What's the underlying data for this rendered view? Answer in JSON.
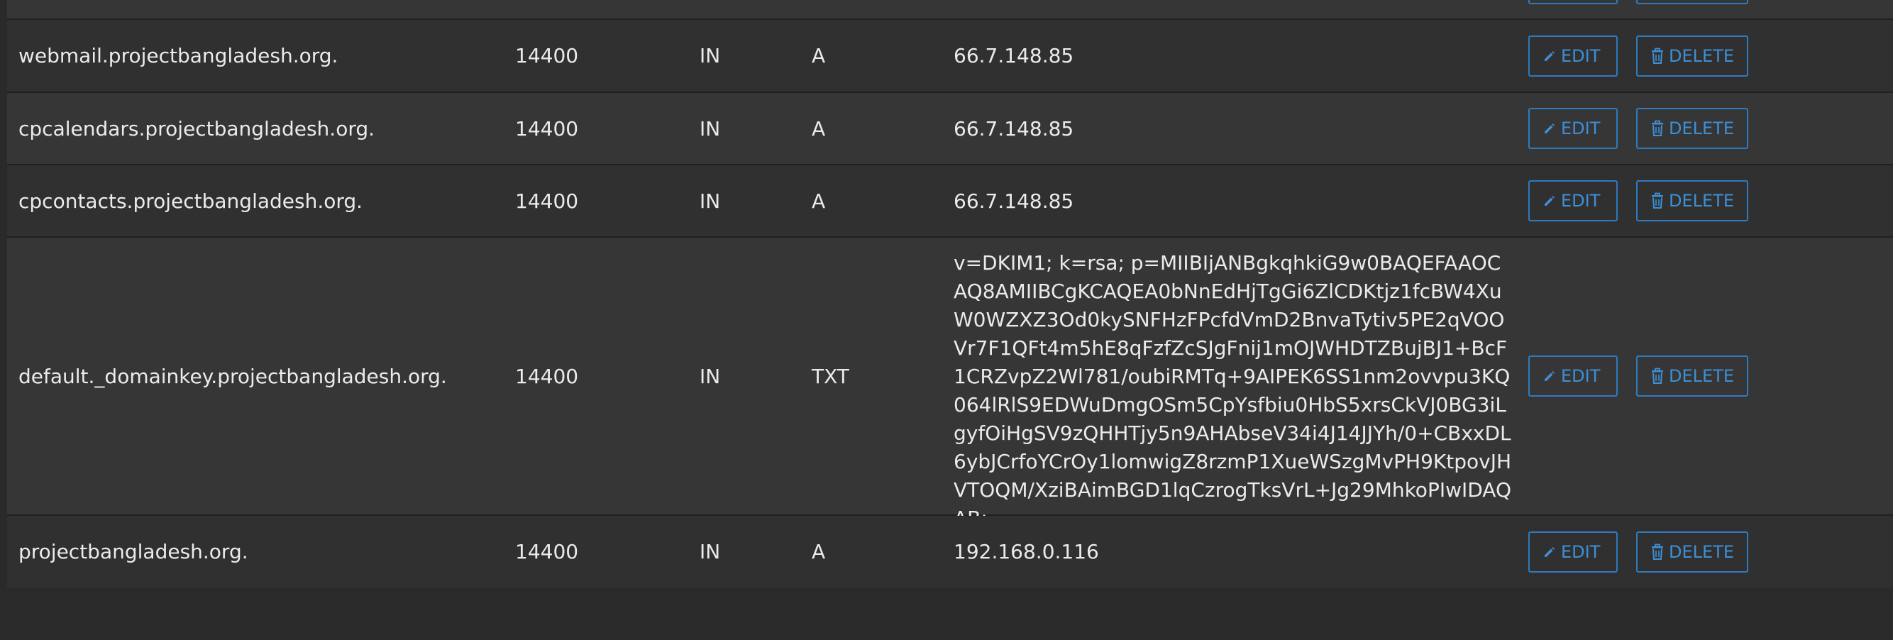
{
  "colors": {
    "page_background": "#2a2a2b",
    "row_odd": "#303031",
    "row_even": "#363637",
    "text": "#ebebeb",
    "button_accent": "#3d8fd8",
    "button_border": "#2f7ac0"
  },
  "actions": {
    "edit_label": "EDIT",
    "delete_label": "DELETE",
    "edit_icon": "pencil-icon",
    "delete_icon": "trash-icon"
  },
  "records": [
    {
      "name": "webmail.projectbangladesh.org.",
      "ttl": "14400",
      "class": "IN",
      "type": "A",
      "record": "66.7.148.85"
    },
    {
      "name": "cpcalendars.projectbangladesh.org.",
      "ttl": "14400",
      "class": "IN",
      "type": "A",
      "record": "66.7.148.85"
    },
    {
      "name": "cpcontacts.projectbangladesh.org.",
      "ttl": "14400",
      "class": "IN",
      "type": "A",
      "record": "66.7.148.85"
    },
    {
      "name": "default._domainkey.projectbangladesh.org.",
      "ttl": "14400",
      "class": "IN",
      "type": "TXT",
      "record": "v=DKIM1; k=rsa; p=MIIBIjANBgkqhkiG9w0BAQEFAAOCAQ8AMIIBCgKCAQEA0bNnEdHjTgGi6ZlCDKtjz1fcBW4XuW0WZXZ3Od0kySNFHzFPcfdVmD2BnvaTytiv5PE2qVOOVr7F1QFt4m5hE8qFzfZcSJgFnij1mOJWHDTZBujBJ1+BcF1CRZvpZ2Wl781/oubiRMTq+9AIPEK6SS1nm2ovvpu3KQ064lRlS9EDWuDmgOSm5CpYsfbiu0HbS5xrsCkVJ0BG3iLgyfOiHgSV9zQHHTjy5n9AHAbseV34i4J14JJYh/0+CBxxDL6ybJCrfoYCrOy1lomwigZ8rzmP1XueWSzgMvPH9KtpovJHVTOQM/XziBAimBGD1lqCzrogTksVrL+Jg29MhkoPIwIDAQAB;"
    },
    {
      "name": "projectbangladesh.org.",
      "ttl": "14400",
      "class": "IN",
      "type": "A",
      "record": "192.168.0.116"
    }
  ]
}
